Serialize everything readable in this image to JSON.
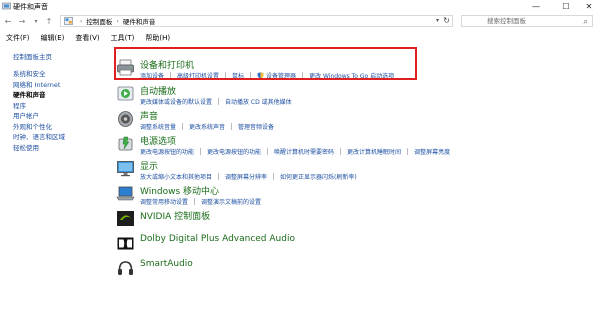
{
  "window": {
    "title": "硬件和声音"
  },
  "address": {
    "crumbs": [
      "控制面板",
      "硬件和声音"
    ],
    "search_placeholder": "搜索控制面板"
  },
  "menu": [
    "文件(F)",
    "编辑(E)",
    "查看(V)",
    "工具(T)",
    "帮助(H)"
  ],
  "sidebar": {
    "home": "控制面板主页",
    "items": [
      {
        "label": "系统和安全",
        "active": false
      },
      {
        "label": "网络和 Internet",
        "active": false
      },
      {
        "label": "硬件和声音",
        "active": true
      },
      {
        "label": "程序",
        "active": false
      },
      {
        "label": "用户帐户",
        "active": false
      },
      {
        "label": "外观和个性化",
        "active": false
      },
      {
        "label": "时钟、语言和区域",
        "active": false
      },
      {
        "label": "轻松使用",
        "active": false
      }
    ]
  },
  "categories": [
    {
      "title": "设备和打印机",
      "icon": "printer-icon",
      "links": [
        "添加设备",
        "高级打印机设置",
        "鼠标",
        "设备管理器",
        "更改 Windows To Go 启动选项"
      ],
      "shield_link_index": 3
    },
    {
      "title": "自动播放",
      "icon": "autoplay-icon",
      "links": [
        "更改媒体或设备的默认设置",
        "自动播放 CD 或其他媒体"
      ]
    },
    {
      "title": "声音",
      "icon": "speaker-icon",
      "links": [
        "调整系统音量",
        "更改系统声音",
        "管理音频设备"
      ]
    },
    {
      "title": "电源选项",
      "icon": "power-icon",
      "links": [
        "更改电源按钮的功能",
        "更改电源按钮的功能",
        "唤醒计算机时需要密码",
        "更改计算机睡眠时间",
        "调整屏幕亮度"
      ]
    },
    {
      "title": "显示",
      "icon": "monitor-icon",
      "links": [
        "放大或缩小文本和其他项目",
        "调整屏幕分辨率",
        "如何更正显示器闪烁(刷新率)"
      ]
    },
    {
      "title": "Windows 移动中心",
      "icon": "mobility-center-icon",
      "links": [
        "调整常用移动设置",
        "调整演示文稿前的设置"
      ]
    },
    {
      "title": "NVIDIA 控制面板",
      "icon": "nvidia-icon",
      "links": []
    },
    {
      "title": "Dolby Digital Plus Advanced Audio",
      "icon": "dolby-icon",
      "links": []
    },
    {
      "title": "SmartAudio",
      "icon": "headphones-icon",
      "links": []
    }
  ],
  "colors": {
    "link": "#1e50a2",
    "category_title": "#1b6d1b",
    "highlight": "#e02020"
  }
}
